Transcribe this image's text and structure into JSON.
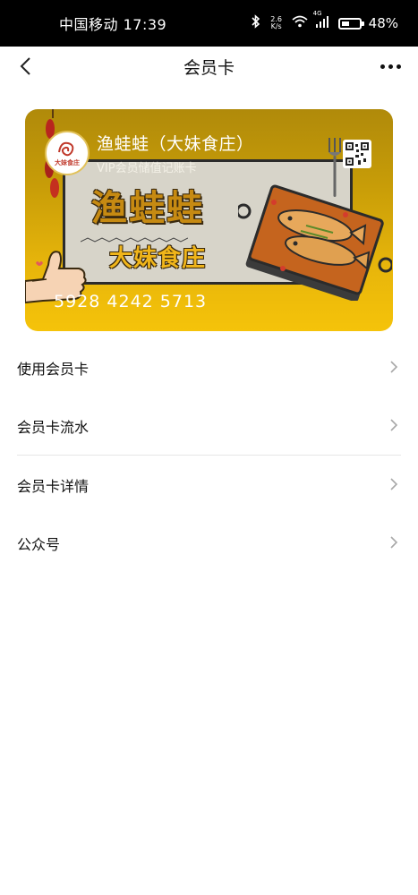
{
  "status_bar": {
    "carrier_time": "中国移动 17:39",
    "speed_value": "2.6",
    "speed_unit": "K/s",
    "network": "4G",
    "battery_percent": "48%",
    "battery_level": 0.48
  },
  "navbar": {
    "title": "会员卡",
    "back_icon": "chevron-left-icon",
    "more_icon": "more-dots-icon"
  },
  "card": {
    "shop_name": "渔蛙蛙（大妹食庄）",
    "card_type": "VIP会员储值记账卡",
    "logo_text": "大妹食庄",
    "big_name": "渔蛙蛙",
    "sub_name": "大妹食庄",
    "card_number": "5928 4242 5713",
    "accent_color": "#f5c30a"
  },
  "menu": {
    "items": [
      {
        "label": "使用会员卡"
      },
      {
        "label": "会员卡流水"
      },
      {
        "label": "会员卡详情"
      },
      {
        "label": "公众号"
      }
    ]
  }
}
